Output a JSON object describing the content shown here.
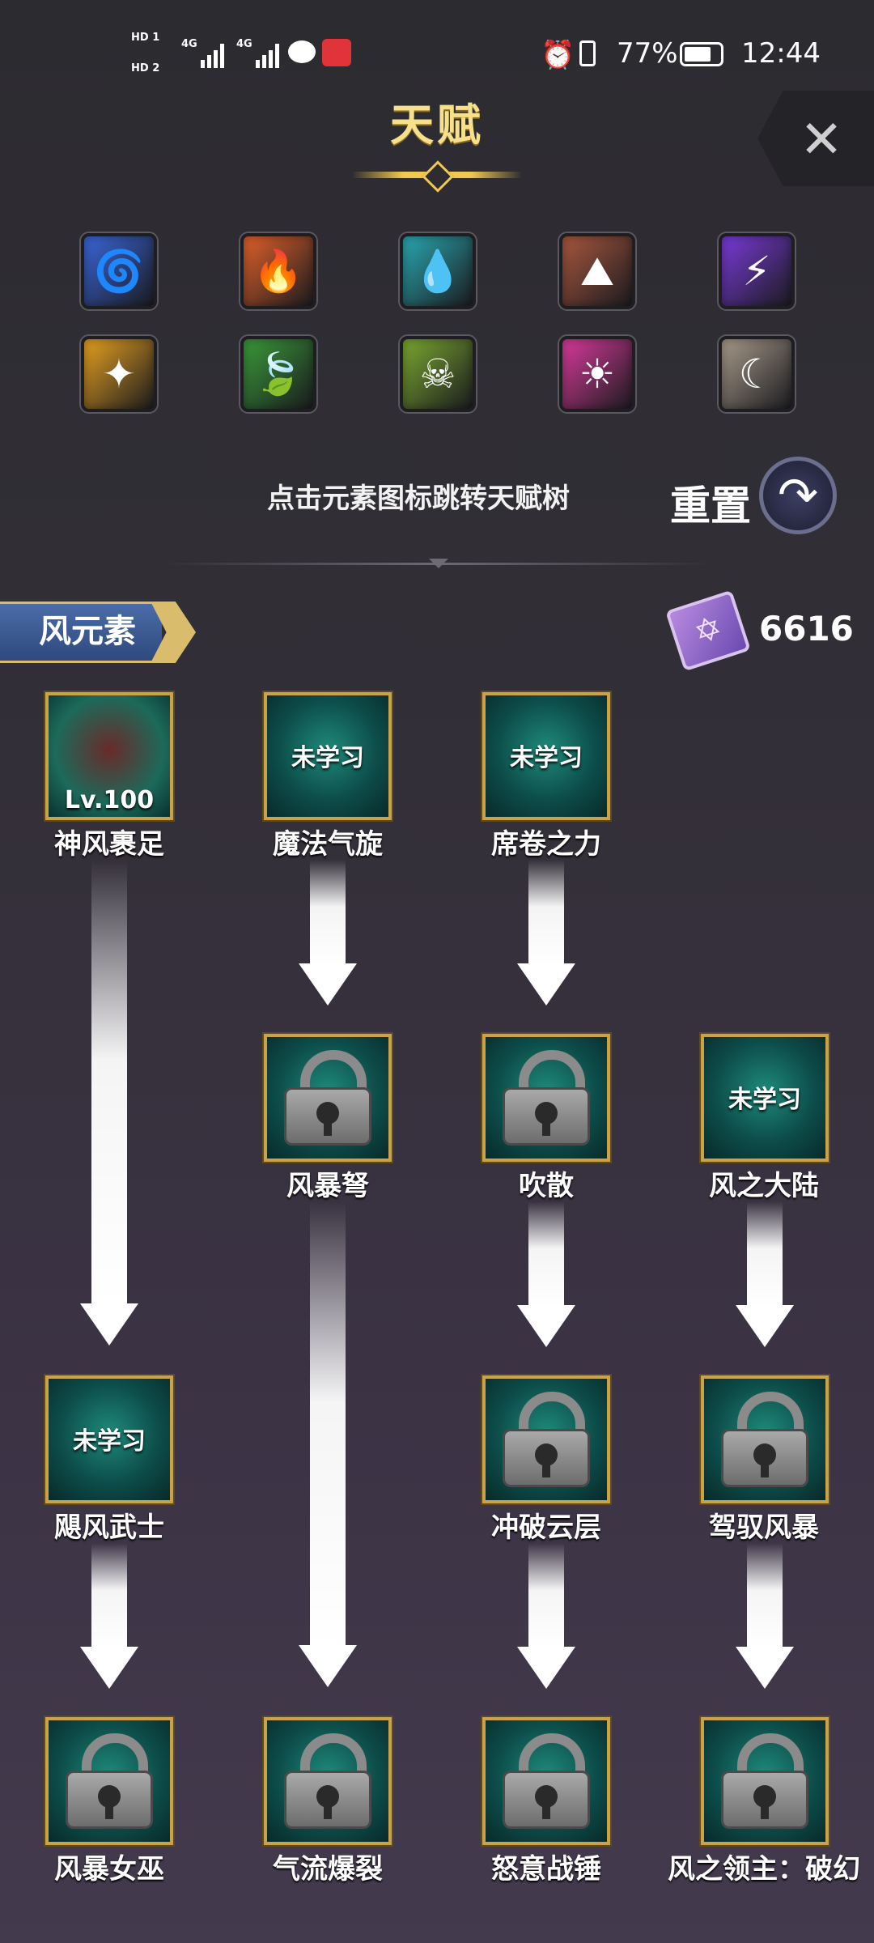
{
  "status_bar": {
    "hd1": "HD 1",
    "hd2": "HD 2",
    "net1": "4G",
    "net2": "4G",
    "battery": "77%",
    "time": "12:44"
  },
  "header": {
    "title": "天赋",
    "close_icon": "close-icon"
  },
  "elements": [
    {
      "icon": "whirlwind-icon",
      "glyph": "🌀",
      "color": "#3a66d8"
    },
    {
      "icon": "fire-icon",
      "glyph": "🔥",
      "color": "#e0602a"
    },
    {
      "icon": "water-drop-icon",
      "glyph": "💧",
      "color": "#2aa8b0"
    },
    {
      "icon": "rock-icon",
      "glyph": "⛰",
      "color": "#a8573e"
    },
    {
      "icon": "lightning-icon",
      "glyph": "⚡",
      "color": "#7a3ad8"
    },
    {
      "icon": "light-icon",
      "glyph": "✦",
      "color": "#e6a020"
    },
    {
      "icon": "leaf-icon",
      "glyph": "🍃",
      "color": "#3a9a3a"
    },
    {
      "icon": "skull-icon",
      "glyph": "☠",
      "color": "#7aa830"
    },
    {
      "icon": "sun-icon",
      "glyph": "☀",
      "color": "#d83a9a"
    },
    {
      "icon": "moon-icon",
      "glyph": "☾",
      "color": "#a89a8a"
    }
  ],
  "hint": "点击元素图标跳转天赋树",
  "reset_label": "重置",
  "section": {
    "name": "风元素",
    "points": "6616"
  },
  "nodes": {
    "r1c1": {
      "name": "神风裹足",
      "level": "Lv.100",
      "status": ""
    },
    "r1c2": {
      "name": "魔法气旋",
      "status": "未学习"
    },
    "r1c3": {
      "name": "席卷之力",
      "status": "未学习"
    },
    "r2c2": {
      "name": "风暴弩",
      "status": ""
    },
    "r2c3": {
      "name": "吹散",
      "status": ""
    },
    "r2c4": {
      "name": "风之大陆",
      "status": "未学习"
    },
    "r3c1": {
      "name": "飓风武士",
      "status": "未学习"
    },
    "r3c3": {
      "name": "冲破云层",
      "status": ""
    },
    "r3c4": {
      "name": "驾驭风暴",
      "status": ""
    },
    "r4c1": {
      "name": "风暴女巫",
      "status": ""
    },
    "r4c2": {
      "name": "气流爆裂",
      "status": ""
    },
    "r4c3": {
      "name": "怒意战锤",
      "status": ""
    },
    "r4c4": {
      "name": "风之领主：破幻",
      "status": ""
    }
  }
}
